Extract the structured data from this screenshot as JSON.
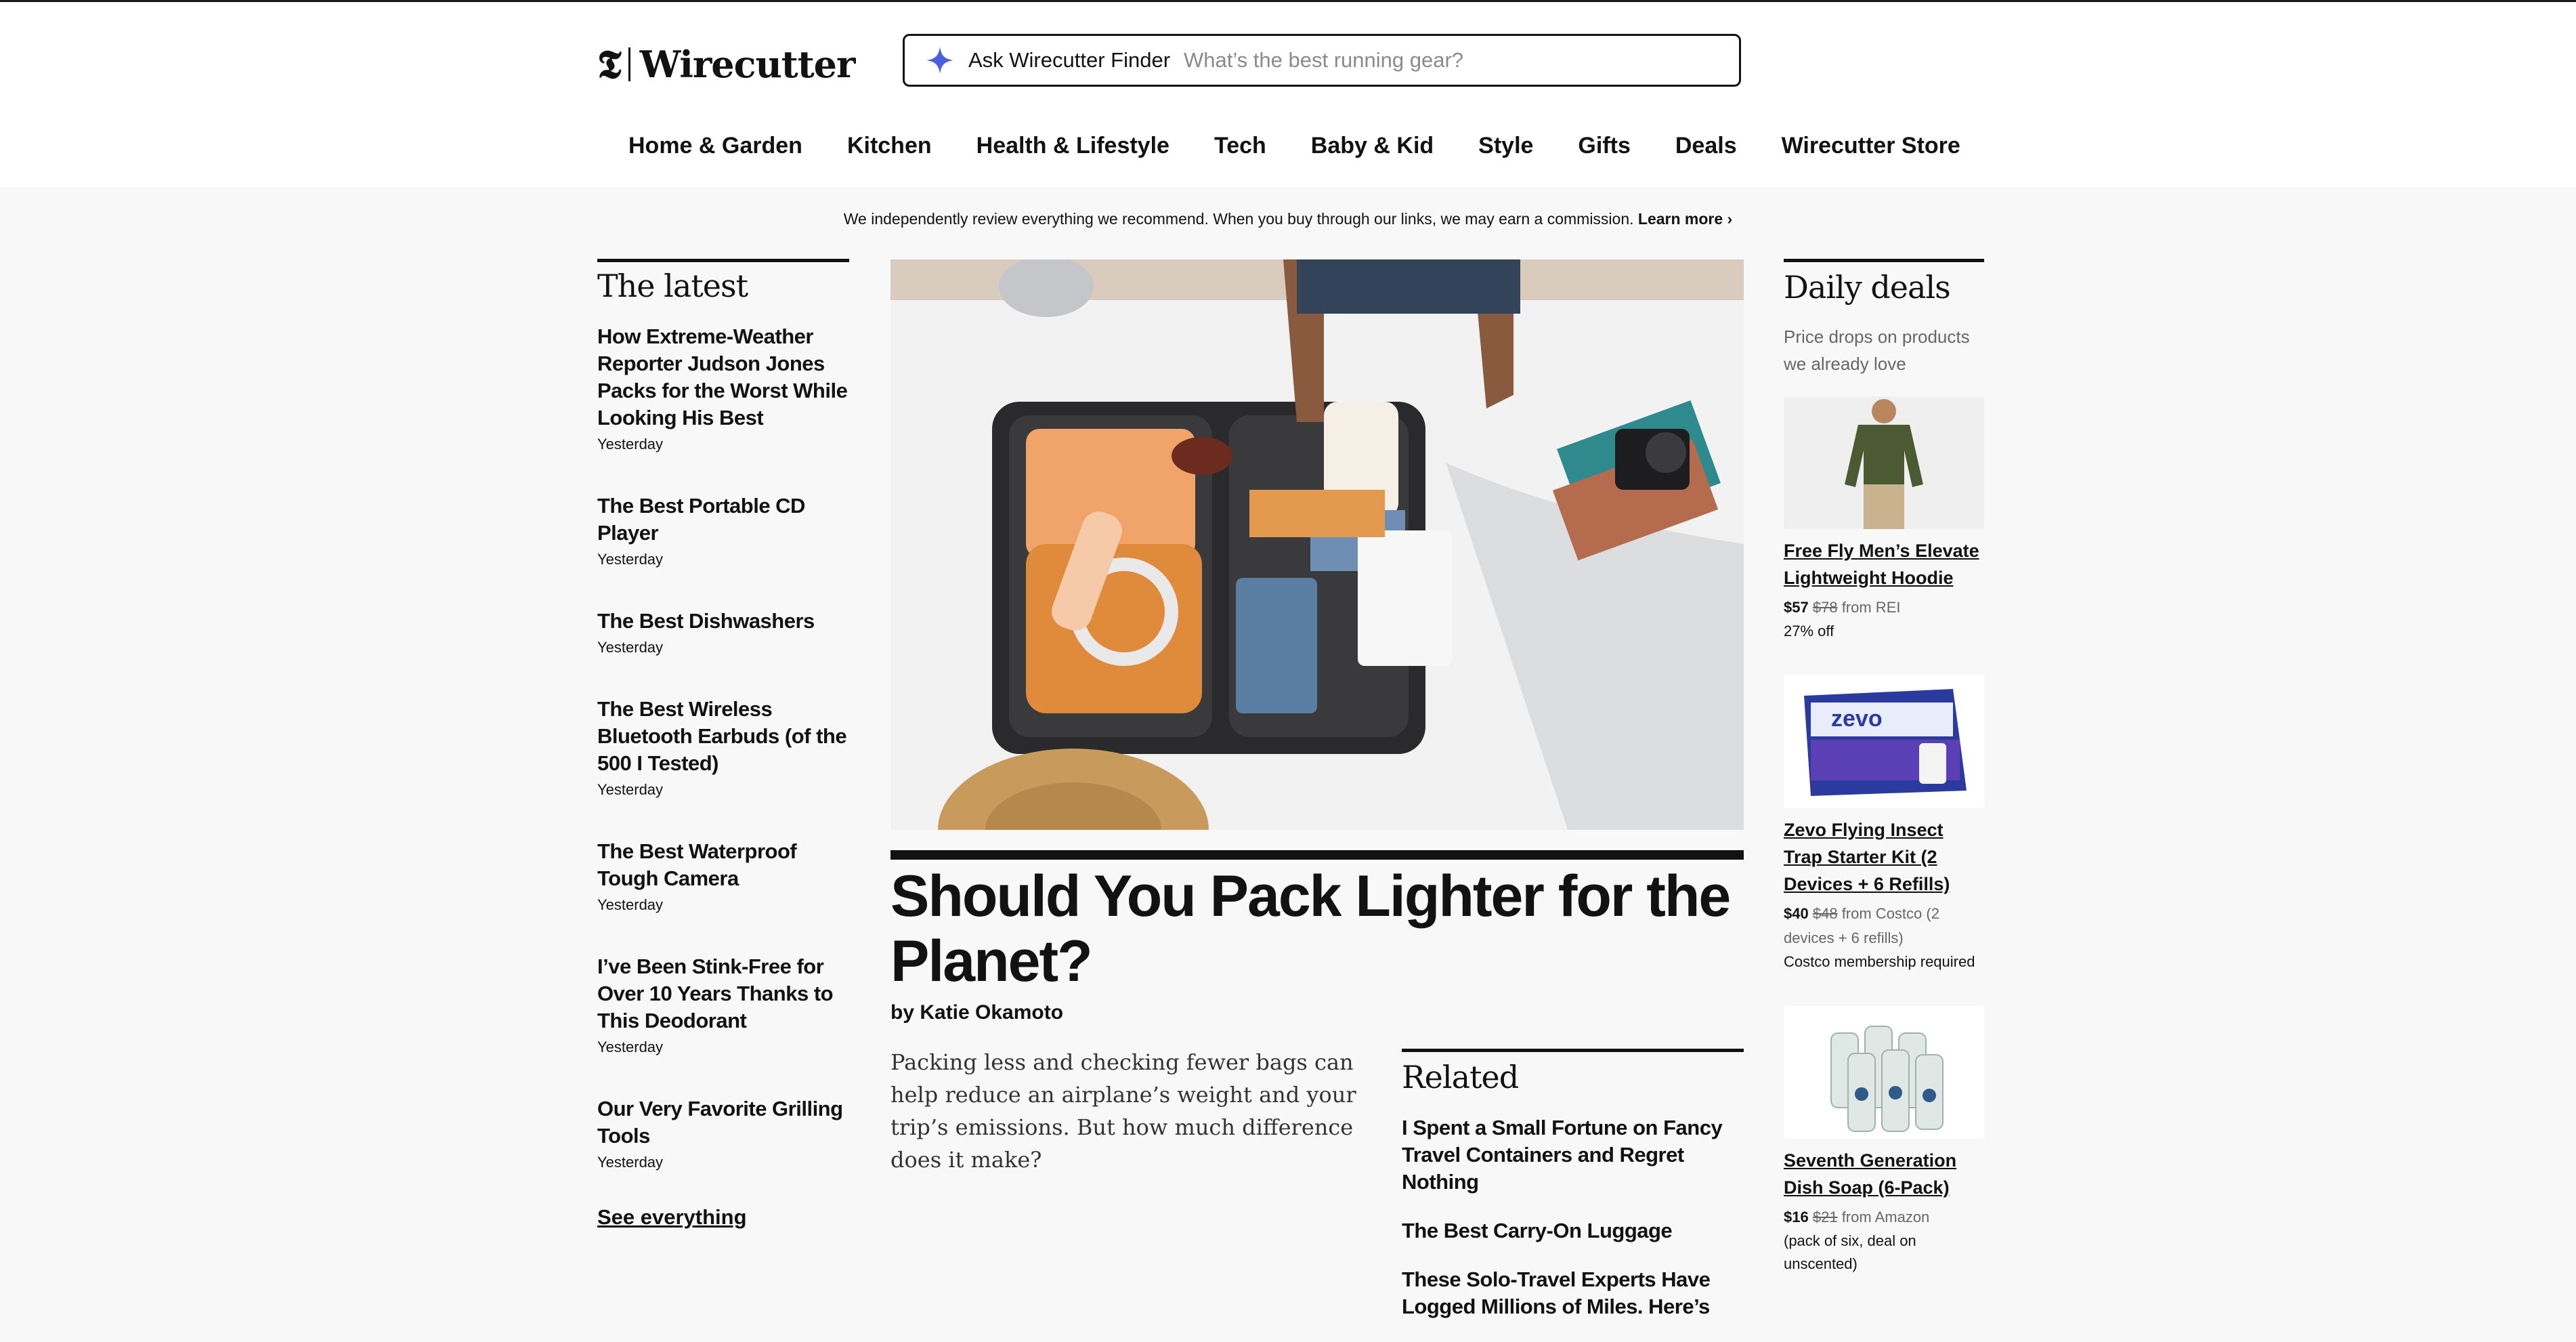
{
  "header": {
    "logo_text": "Wirecutter",
    "finder_label": "Ask Wirecutter Finder",
    "finder_placeholder": "What’s the best running gear?"
  },
  "nav": [
    "Home & Garden",
    "Kitchen",
    "Health & Lifestyle",
    "Tech",
    "Baby & Kid",
    "Style",
    "Gifts",
    "Deals",
    "Wirecutter Store"
  ],
  "disclosure": {
    "text": "We independently review everything we recommend. When you buy through our links, we may earn a commission.",
    "link": "Learn more ›"
  },
  "latest": {
    "title": "The latest",
    "items": [
      {
        "title": "How Extreme-Weather Reporter Judson Jones Packs for the Worst While Looking His Best",
        "date": "Yesterday"
      },
      {
        "title": "The Best Portable CD Player",
        "date": "Yesterday"
      },
      {
        "title": "The Best Dishwashers",
        "date": "Yesterday"
      },
      {
        "title": "The Best Wireless Bluetooth Earbuds (of the 500 I Tested)",
        "date": "Yesterday"
      },
      {
        "title": "The Best Waterproof Tough Camera",
        "date": "Yesterday"
      },
      {
        "title": "I’ve Been Stink-Free for Over 10 Years Thanks to This Deodorant",
        "date": "Yesterday"
      },
      {
        "title": "Our Very Favorite Grilling Tools",
        "date": "Yesterday"
      }
    ],
    "see_all": "See everything"
  },
  "feature": {
    "headline": "Should You Pack Lighter for the Planet?",
    "byline": "by Katie Okamoto",
    "dek": "Packing less and checking fewer bags can help reduce an airplane’s weight and your trip’s emissions. But how much difference does it make?"
  },
  "related": {
    "title": "Related",
    "items": [
      "I Spent a Small Fortune on Fancy Travel Containers and Regret Nothing",
      "The Best Carry-On Luggage",
      "These Solo-Travel Experts Have Logged Millions of Miles. Here’s"
    ]
  },
  "deals": {
    "title": "Daily deals",
    "subtitle": "Price drops on products we already love",
    "items": [
      {
        "title": "Free Fly Men’s Elevate Lightweight Hoodie",
        "price": "$57",
        "was": "$78",
        "from": "from REI",
        "note": "27% off"
      },
      {
        "title": "Zevo Flying Insect Trap Starter Kit (2 Devices + 6 Refills)",
        "price": "$40",
        "was": "$48",
        "from": "from Costco (2 devices + 6 refills)",
        "note": "Costco membership required"
      },
      {
        "title": "Seventh Generation Dish Soap (6-Pack)",
        "price": "$16",
        "was": "$21",
        "from": "from Amazon",
        "note": "(pack of six, deal on unscented)"
      }
    ]
  },
  "colors": {
    "accent": "#121212",
    "finder_sparkle": "#4b5fe0",
    "background": "#f8f8f8"
  }
}
